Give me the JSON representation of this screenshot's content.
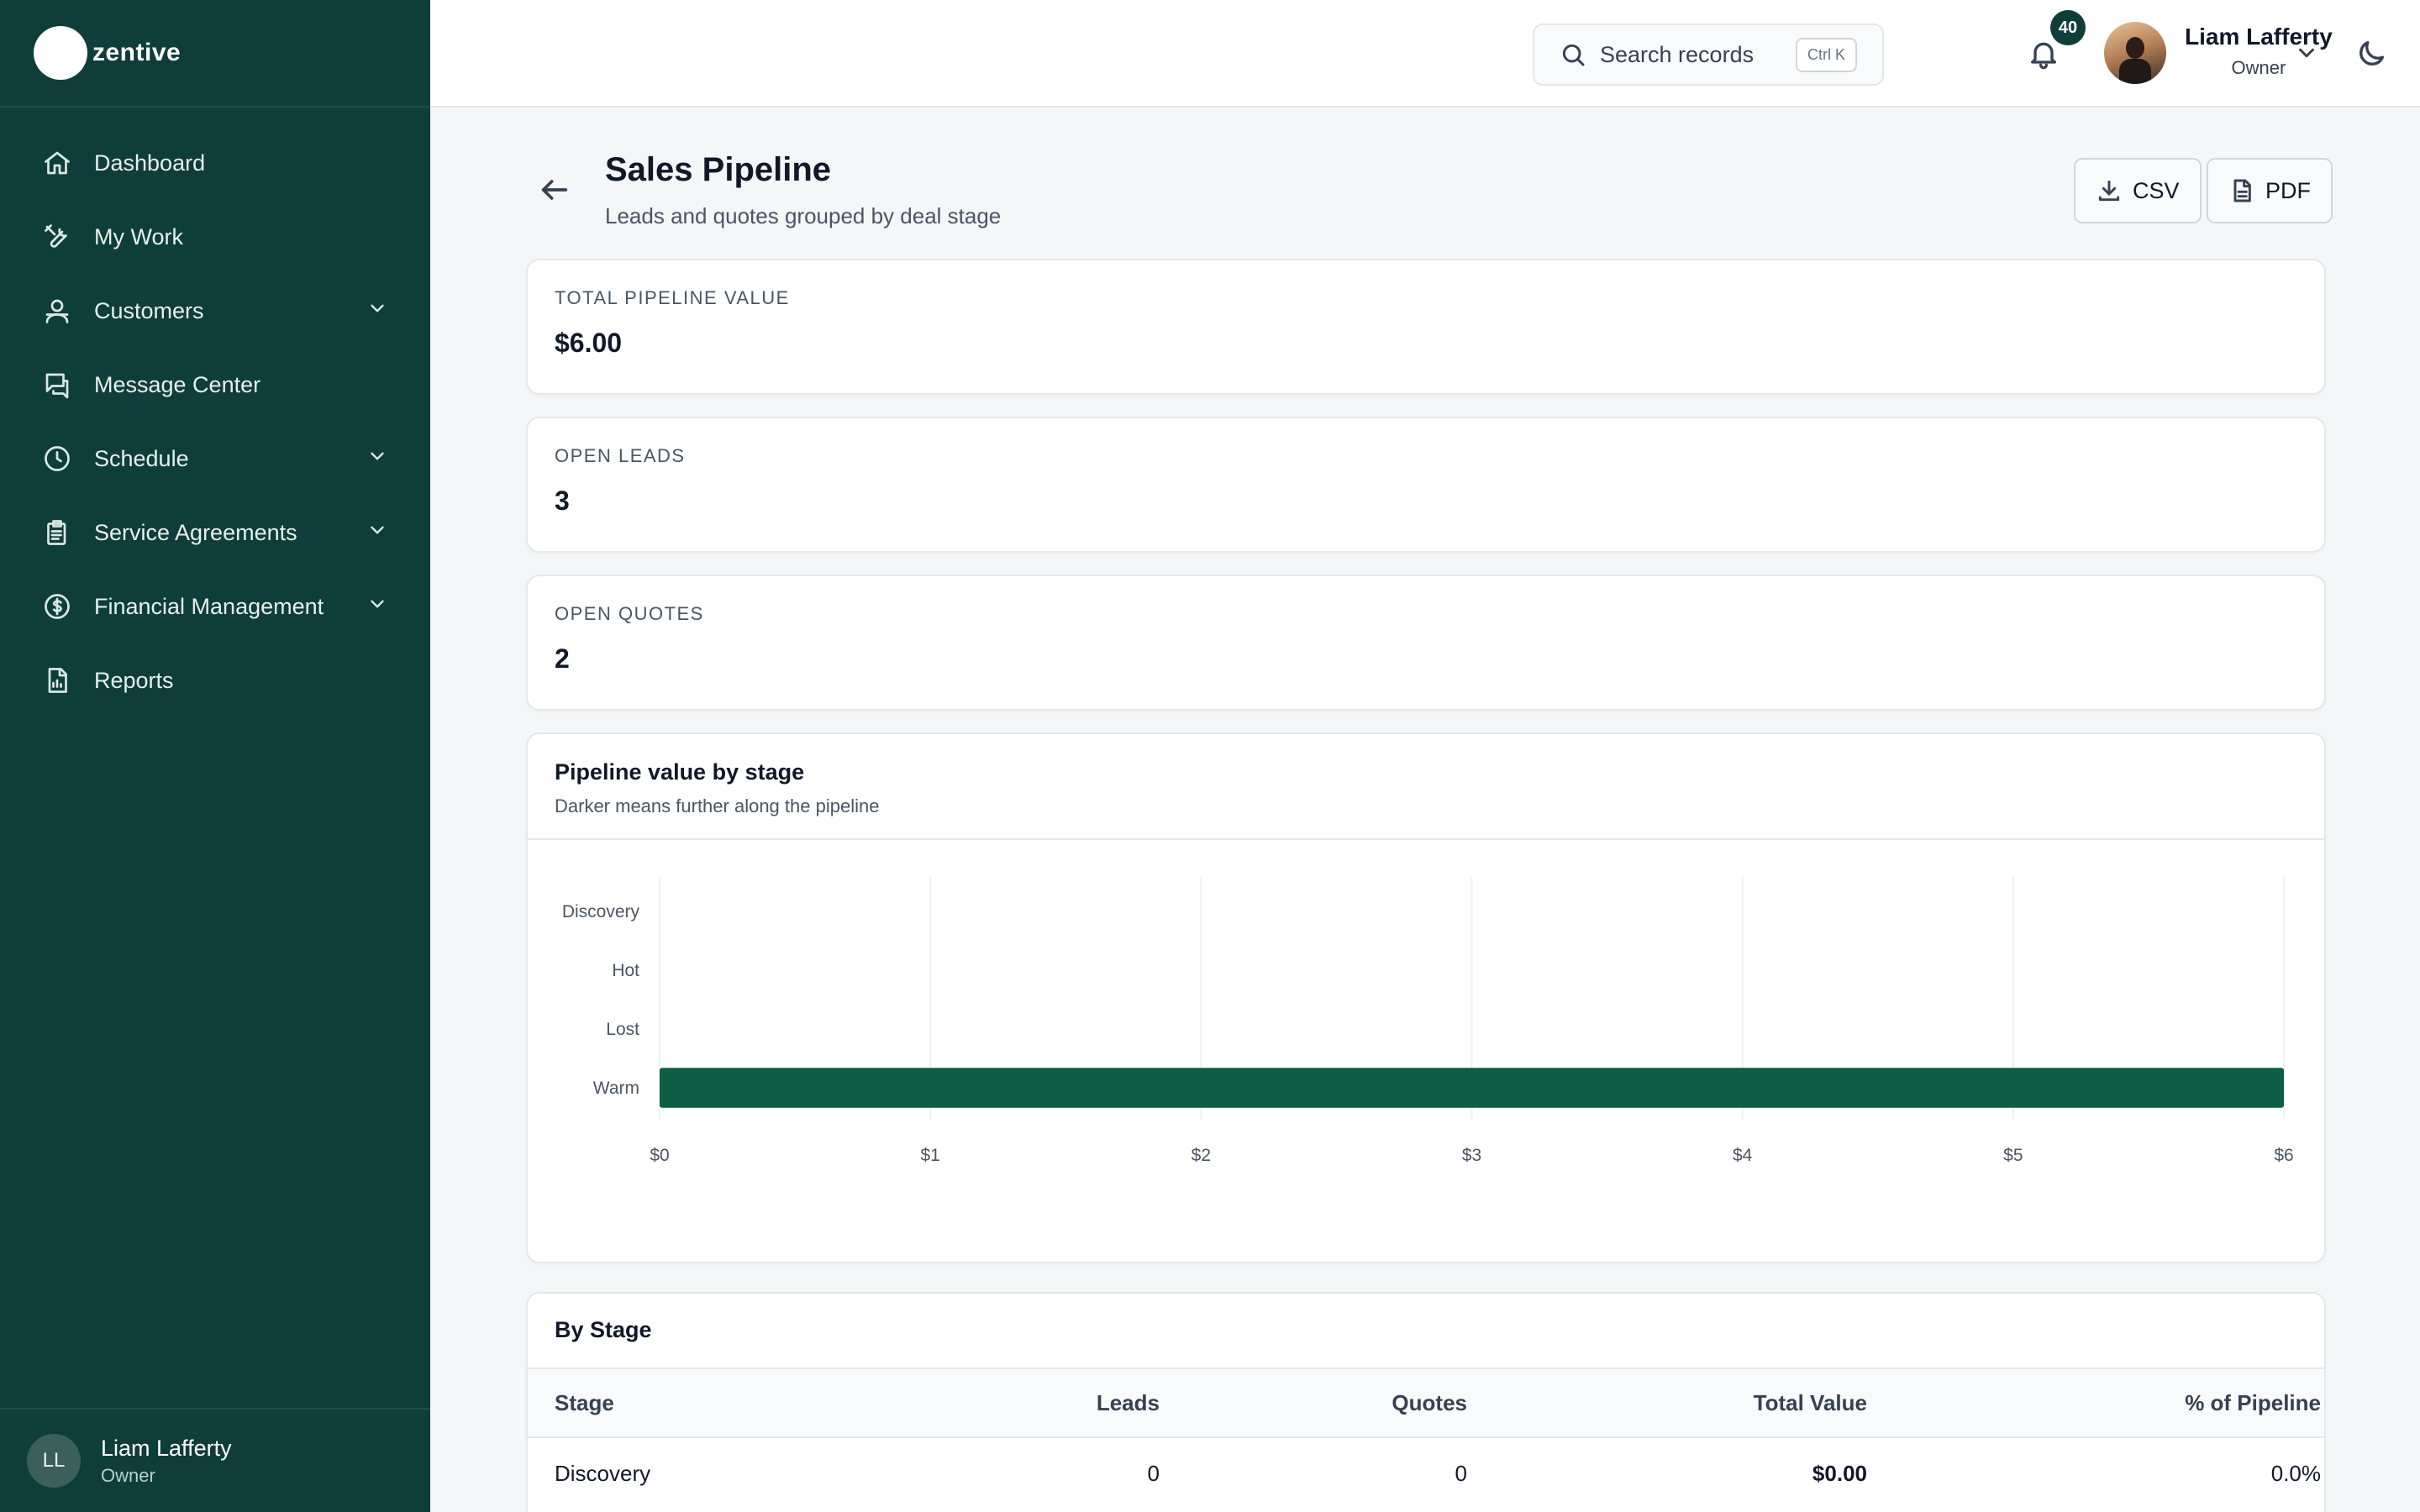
{
  "brand": {
    "name": "zentive"
  },
  "sidebar": {
    "items": [
      {
        "label": "Dashboard",
        "icon": "home-icon",
        "has_children": false
      },
      {
        "label": "My Work",
        "icon": "tools-icon",
        "has_children": false
      },
      {
        "label": "Customers",
        "icon": "users-icon",
        "has_children": true
      },
      {
        "label": "Message Center",
        "icon": "chat-icon",
        "has_children": false
      },
      {
        "label": "Schedule",
        "icon": "clock-icon",
        "has_children": true
      },
      {
        "label": "Service Agreements",
        "icon": "clipboard-icon",
        "has_children": true
      },
      {
        "label": "Financial Management",
        "icon": "dollar-icon",
        "has_children": true
      },
      {
        "label": "Reports",
        "icon": "report-icon",
        "has_children": false
      }
    ],
    "user": {
      "initials": "LL",
      "name": "Liam Lafferty",
      "role": "Owner"
    }
  },
  "topbar": {
    "search_placeholder": "Search records",
    "search_shortcut": "Ctrl K",
    "notification_count": "40",
    "user_name": "Liam Lafferty",
    "user_role": "Owner"
  },
  "page": {
    "title": "Sales Pipeline",
    "subtitle": "Leads and quotes grouped by deal stage",
    "csv_label": "CSV",
    "pdf_label": "PDF"
  },
  "stats": [
    {
      "label": "TOTAL PIPELINE VALUE",
      "value": "$6.00"
    },
    {
      "label": "OPEN LEADS",
      "value": "3"
    },
    {
      "label": "OPEN QUOTES",
      "value": "2"
    }
  ],
  "chart_card": {
    "title": "Pipeline value by stage",
    "subtitle": "Darker means further along the pipeline"
  },
  "chart_data": {
    "type": "bar",
    "orientation": "horizontal",
    "categories": [
      "Discovery",
      "Hot",
      "Lost",
      "Warm"
    ],
    "values": [
      0,
      0,
      0,
      6
    ],
    "xlim": [
      0,
      6
    ],
    "x_ticks": [
      "$0",
      "$1",
      "$2",
      "$3",
      "$4",
      "$5",
      "$6"
    ],
    "grid": true,
    "bar_color": "#0e5e45"
  },
  "table": {
    "title": "By Stage",
    "columns": [
      "Stage",
      "Leads",
      "Quotes",
      "Total Value",
      "% of Pipeline"
    ],
    "rows": [
      [
        "Discovery",
        "0",
        "0",
        "$0.00",
        "0.0%"
      ]
    ]
  },
  "colors": {
    "sidebar": "#0f3d3a",
    "accent": "#0e5e45"
  }
}
